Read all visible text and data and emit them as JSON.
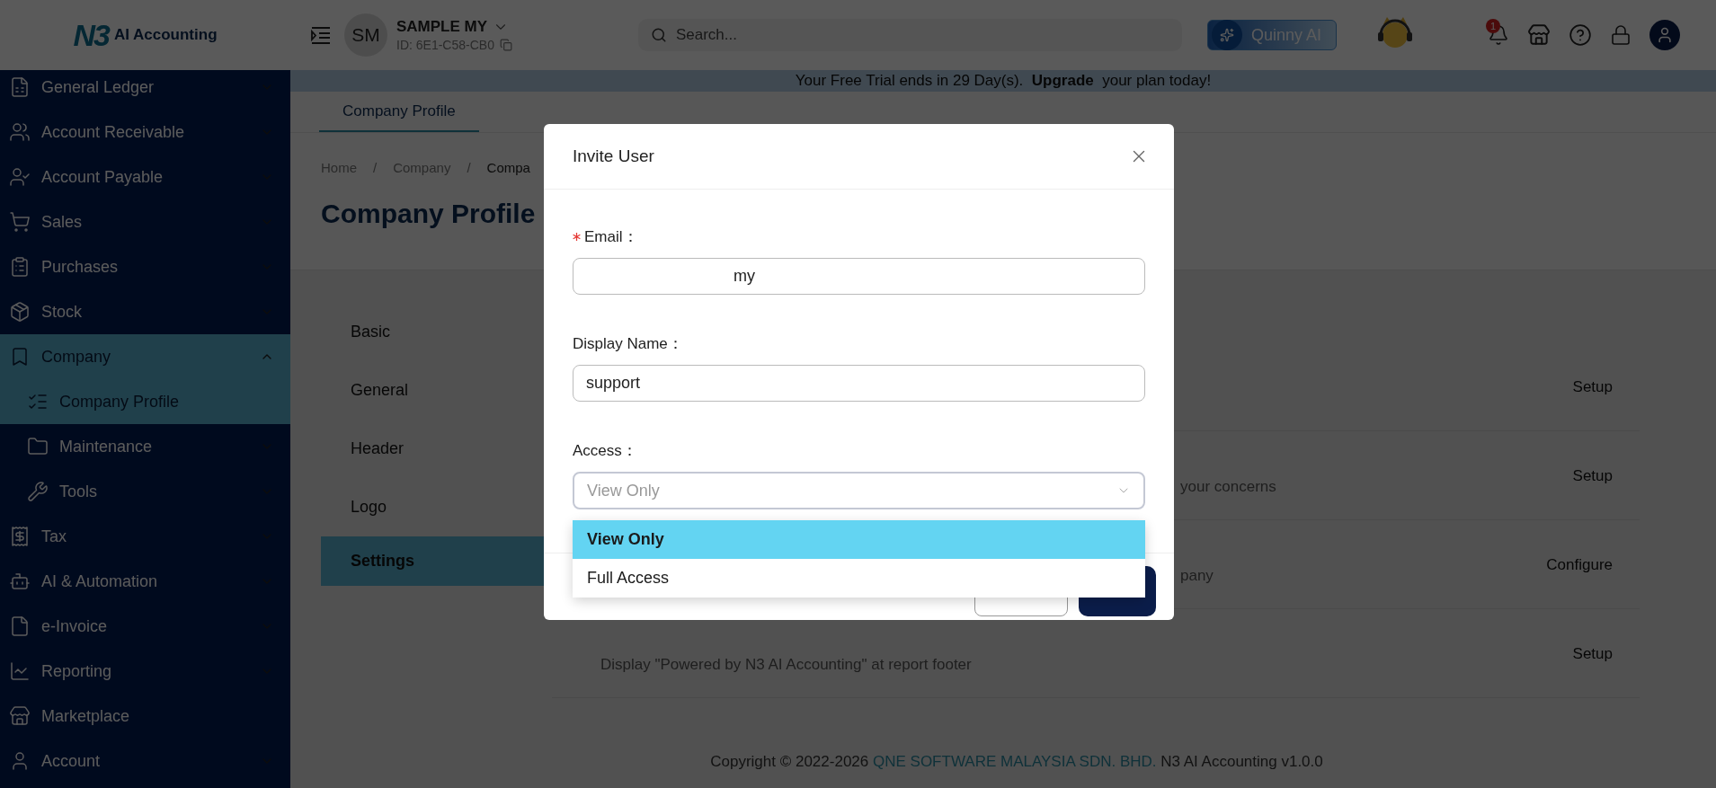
{
  "header": {
    "logo_mark": "N3",
    "logo_text": "AI Accounting",
    "company_initials": "SM",
    "company_name": "SAMPLE MY",
    "company_id": "ID: 6E1-C58-CB0",
    "search": {
      "placeholder": "Search..."
    },
    "assistant_button": "Quinny AI",
    "notification_badge": "1"
  },
  "sidebar": {
    "items": [
      {
        "label": "General Ledger",
        "kind": "group",
        "expanded": false,
        "selected": false
      },
      {
        "label": "Account Receivable",
        "kind": "group",
        "expanded": false,
        "selected": false
      },
      {
        "label": "Account Payable",
        "kind": "group",
        "expanded": false,
        "selected": false
      },
      {
        "label": "Sales",
        "kind": "group",
        "expanded": false,
        "selected": false
      },
      {
        "label": "Purchases",
        "kind": "group",
        "expanded": false,
        "selected": false
      },
      {
        "label": "Stock",
        "kind": "group",
        "expanded": false,
        "selected": false
      },
      {
        "label": "Company",
        "kind": "group",
        "expanded": true,
        "selected": true,
        "children": [
          {
            "label": "Company Profile",
            "kind": "link",
            "selected": true
          },
          {
            "label": "Maintenance",
            "kind": "group",
            "expanded": false,
            "selected": false
          },
          {
            "label": "Tools",
            "kind": "group",
            "expanded": false,
            "selected": false
          }
        ]
      },
      {
        "label": "Tax",
        "kind": "group",
        "expanded": false,
        "selected": false
      },
      {
        "label": "AI & Automation",
        "kind": "group",
        "expanded": false,
        "selected": false
      },
      {
        "label": "e-Invoice",
        "kind": "group",
        "expanded": false,
        "selected": false
      },
      {
        "label": "Reporting",
        "kind": "group",
        "expanded": false,
        "selected": false
      },
      {
        "label": "Marketplace",
        "kind": "link",
        "selected": false
      },
      {
        "label": "Account",
        "kind": "group",
        "expanded": false,
        "selected": false
      }
    ]
  },
  "banner": "Your Free Trial ends in 29 Day(s).  **Upgrade**  your plan today!",
  "tabs": [
    {
      "label": "Company Profile",
      "selected": true
    }
  ],
  "breadcrumb": [
    {
      "kind": "link",
      "text": "Home"
    },
    {
      "kind": "separator",
      "text": "/"
    },
    {
      "kind": "link",
      "text": "Company"
    },
    {
      "kind": "separator",
      "text": "/"
    },
    {
      "kind": "current",
      "text": "Compa"
    }
  ],
  "page_title": "Company Profile",
  "settings_menu": [
    {
      "label": "Basic",
      "selected": false
    },
    {
      "label": "General",
      "selected": false
    },
    {
      "label": "Header",
      "selected": false
    },
    {
      "label": "Logo",
      "selected": false
    },
    {
      "label": "Settings",
      "selected": true
    }
  ],
  "settings_rows": [
    {
      "action": "Setup"
    },
    {
      "kind": "covered",
      "description": "your concerns",
      "action": "Setup"
    },
    {
      "kind": "covered",
      "description": "pany",
      "action": "Configure"
    },
    {
      "kind": "plain",
      "description": "Display \"Powered by N3 AI Accounting\" at report footer",
      "action": "Setup"
    }
  ],
  "footer": {
    "prefix": "Copyright © 2022-2026",
    "company_link": "QNE SOFTWARE MALAYSIA SDN. BHD.",
    "suffix": "N3 AI Accounting v1.0.0"
  },
  "dialog": {
    "title": "Invite User",
    "fields": [
      {
        "label": "Email：",
        "required": true,
        "value": "my"
      },
      {
        "label": "Display Name：",
        "required": false,
        "value": "support"
      }
    ],
    "access": {
      "label": "Access：",
      "value": "View Only",
      "open": true,
      "options": [
        {
          "label": "View Only",
          "selected": true
        },
        {
          "label": "Full Access",
          "selected": false
        }
      ]
    }
  }
}
